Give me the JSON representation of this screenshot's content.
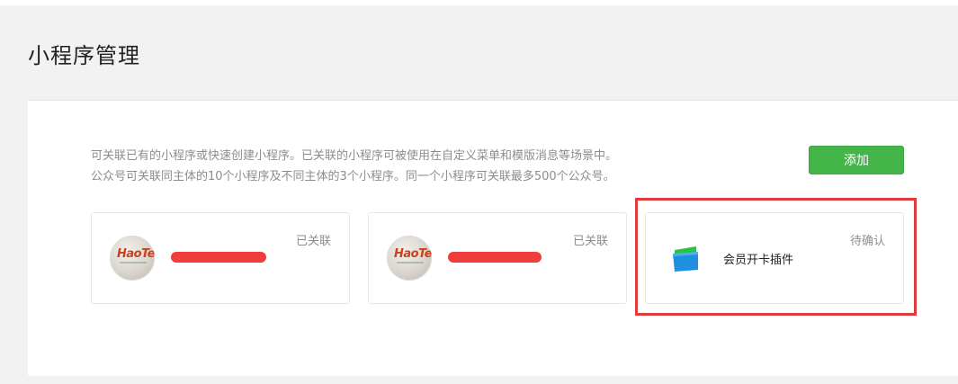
{
  "page": {
    "title": "小程序管理"
  },
  "description": {
    "line1": "可关联已有的小程序或快速创建小程序。已关联的小程序可被使用在自定义菜单和模版消息等场景中。",
    "line2": "公众号可关联同主体的10个小程序及不同主体的3个小程序。同一个小程序可关联最多500个公众号。"
  },
  "actions": {
    "add_label": "添加"
  },
  "cards": [
    {
      "status": "已关联",
      "logo_text": "HaoTeam",
      "avatar_icon": "haoteam-logo"
    },
    {
      "status": "已关联",
      "logo_text": "HaoTeam",
      "avatar_icon": "haoteam-logo"
    },
    {
      "status": "待确认",
      "name": "会员开卡插件",
      "icon": "member-card-icon"
    }
  ],
  "colors": {
    "accent_green": "#44b549",
    "highlight_red": "#e33b3b",
    "redaction_red": "#ee3333",
    "card_icon_green": "#2ac33f",
    "card_icon_blue": "#1f8fe0"
  }
}
